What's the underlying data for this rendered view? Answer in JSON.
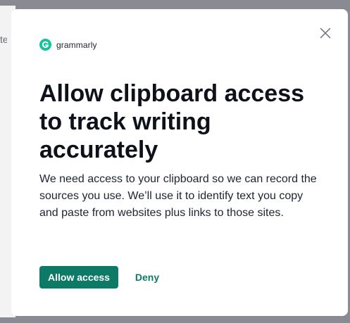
{
  "background": {
    "partial_text": "te"
  },
  "dialog": {
    "brand": {
      "name": "grammarly",
      "logo_icon": "grammarly-g-icon",
      "color": "#15c39a"
    },
    "close_icon": "close-icon",
    "title": "Allow clipboard access to track writing accurately",
    "body": "We need access to your clipboard so we can record the sources you use. We’ll use it to identify text you copy and paste from websites plus links to those sites.",
    "actions": {
      "allow_label": "Allow access",
      "deny_label": "Deny"
    },
    "accent_color": "#0c7a66"
  }
}
